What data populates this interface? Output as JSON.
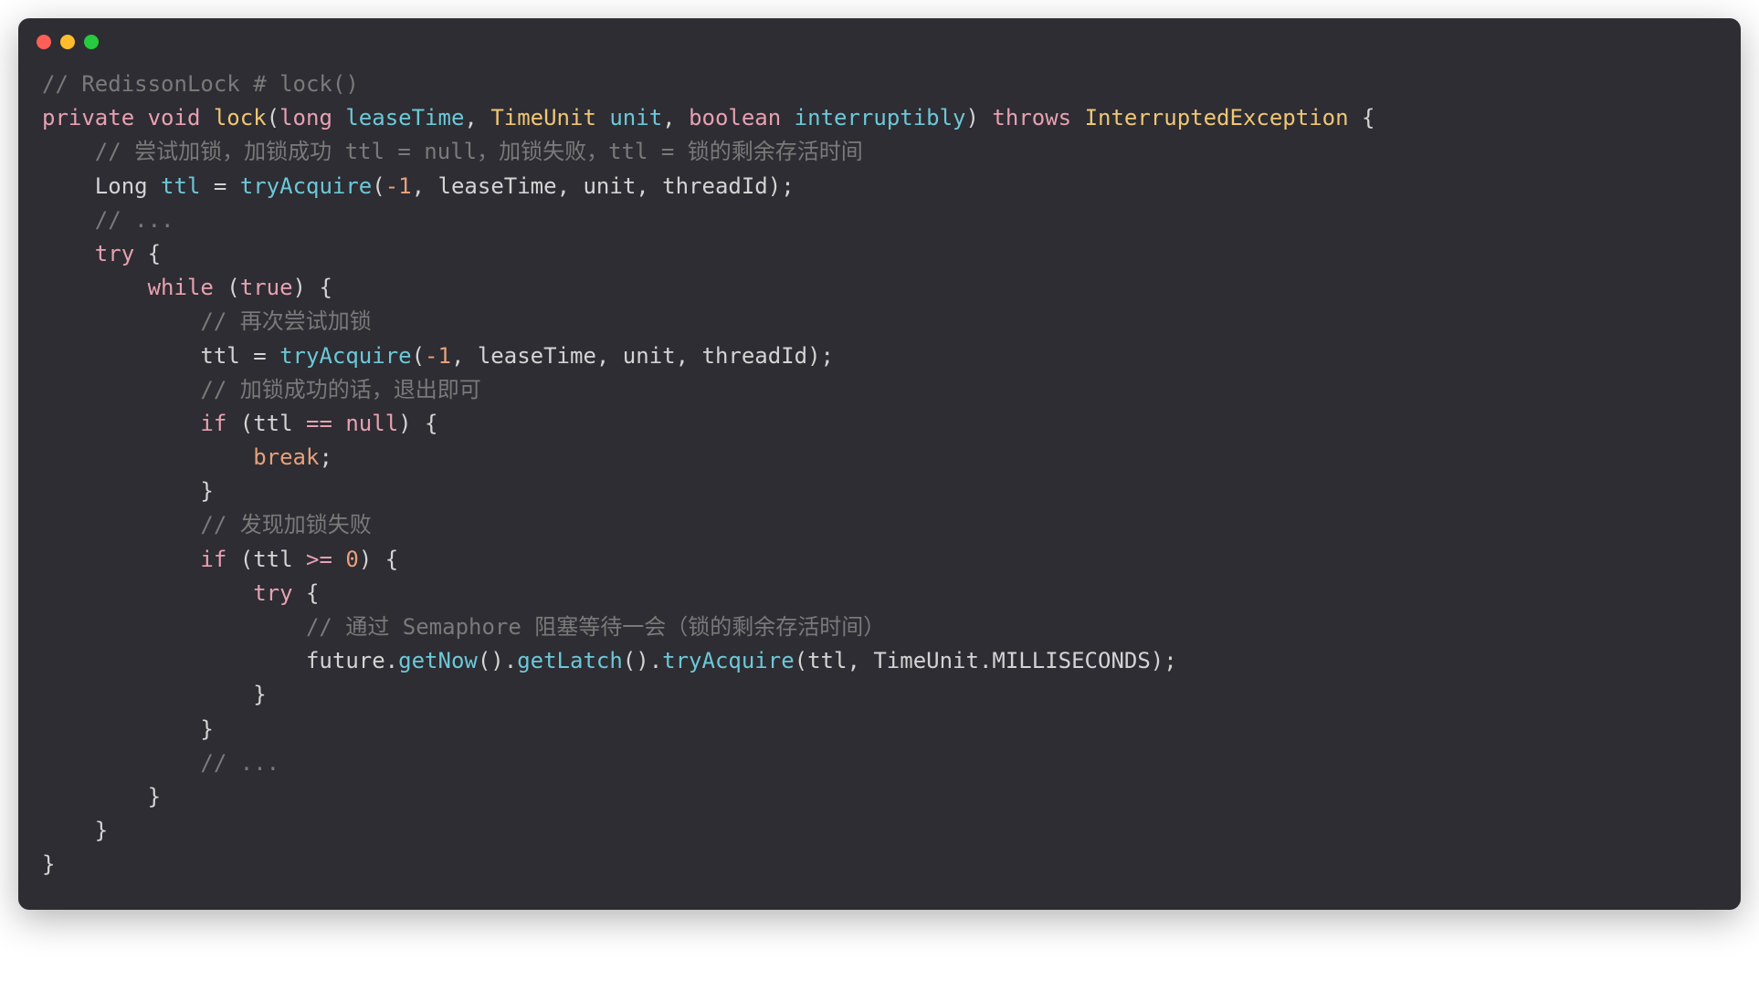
{
  "traffic_lights": {
    "red": "#ff5f56",
    "yellow": "#ffbd2e",
    "green": "#27c93f"
  },
  "code": {
    "l1_comment": "// RedissonLock # lock()",
    "l2_private": "private",
    "l2_void": "void",
    "l2_lock": "lock",
    "l2_lp": "(",
    "l2_long": "long",
    "l2_leaseTime": " leaseTime",
    "l2_c1": ", ",
    "l2_TimeUnit": "TimeUnit",
    "l2_unit": " unit",
    "l2_c2": ", ",
    "l2_boolean": "boolean",
    "l2_interruptibly": " interruptibly",
    "l2_rp": ")",
    "l2_throws": " throws ",
    "l2_Exc": "InterruptedException",
    "l2_ob": " {",
    "l3_comment": "    // 尝试加锁，加锁成功 ttl = null，加锁失败，ttl = 锁的剩余存活时间",
    "l4_Long": "    Long ",
    "l4_ttl": "ttl",
    "l4_eq": " = ",
    "l4_try": "tryAcquire",
    "l4_lp": "(",
    "l4_neg1": "-1",
    "l4_c1": ", leaseTime, unit, threadId);",
    "l5_comment": "    // ...",
    "l6_try": "    try",
    "l6_ob": " {",
    "l7_while": "        while",
    "l7_lp": " (",
    "l7_true": "true",
    "l7_rp": ") {",
    "l8_comment": "            // 再次尝试加锁",
    "l9_ttl": "            ttl = ",
    "l9_try": "tryAcquire",
    "l9_lp": "(",
    "l9_neg1": "-1",
    "l9_rest": ", leaseTime, unit, threadId);",
    "l10_comment": "            // 加锁成功的话，退出即可",
    "l11_if": "            if",
    "l11_lp": " (ttl ",
    "l11_eq": "==",
    "l11_null": " null",
    "l11_rp": ") {",
    "l12_break": "                break",
    "l12_sc": ";",
    "l13_cb": "            }",
    "l14_comment": "            // 发现加锁失败",
    "l15_if": "            if",
    "l15_cond": " (ttl ",
    "l15_gte": ">=",
    "l15_sp": " ",
    "l15_zero": "0",
    "l15_rp": ") {",
    "l16_try": "                try",
    "l16_ob": " {",
    "l17_comment": "                    // 通过 Semaphore 阻塞等待一会（锁的剩余存活时间）",
    "l18_pre": "                    future.",
    "l18_getNow": "getNow",
    "l18_p1": "().",
    "l18_getLatch": "getLatch",
    "l18_p2": "().",
    "l18_tryAcquire": "tryAcquire",
    "l18_lp": "(ttl, TimeUnit.MILLISECONDS);",
    "l19_cb": "                }",
    "l20_cb": "            }",
    "l21_comment": "            // ...",
    "l22_cb": "        }",
    "l23_cb": "    }",
    "l24_cb": "}"
  }
}
